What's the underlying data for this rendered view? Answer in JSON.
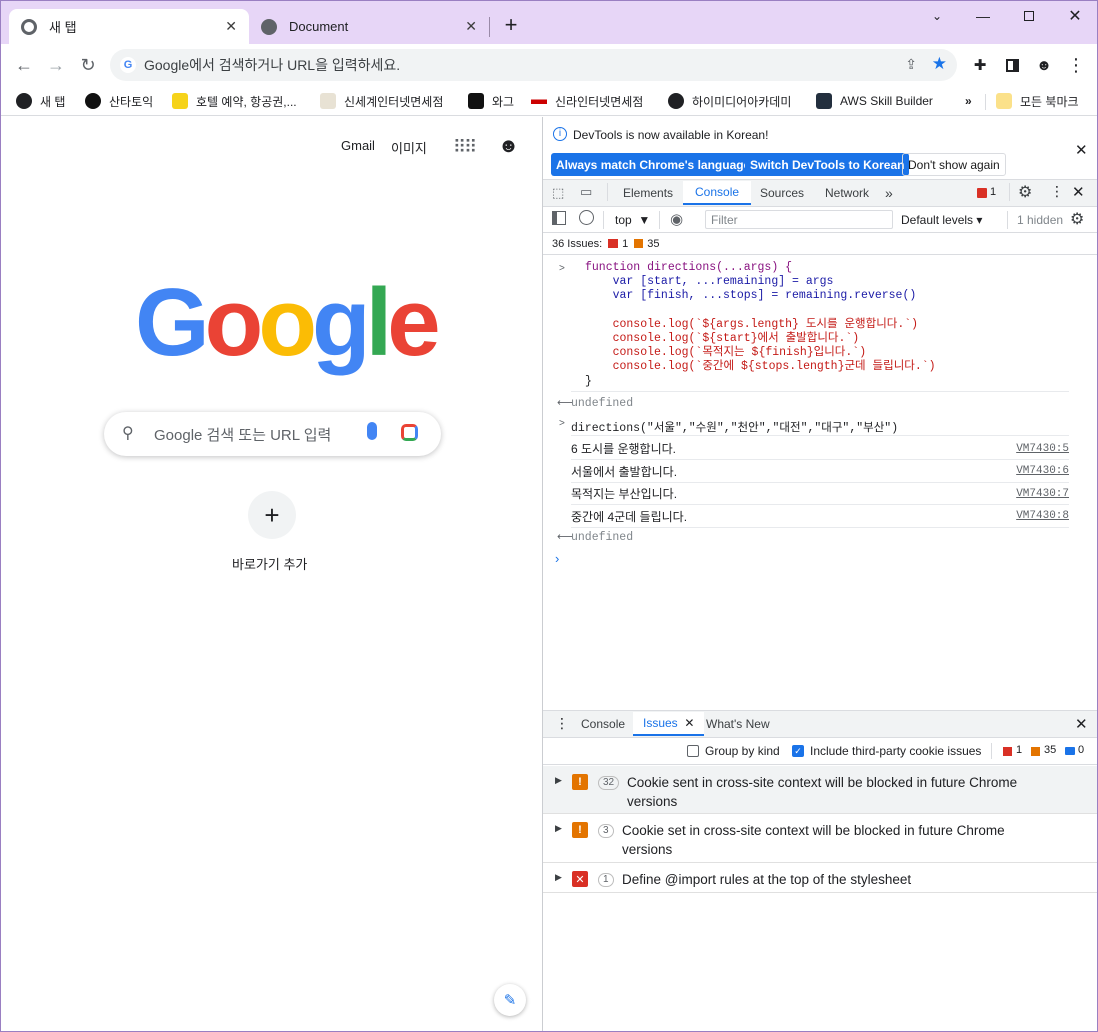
{
  "tabs": [
    {
      "label": "새 탭"
    },
    {
      "label": "Document"
    }
  ],
  "omnibox": {
    "placeholder": "Google에서 검색하거나 URL을 입력하세요."
  },
  "bookmarks": [
    {
      "label": "새 탭"
    },
    {
      "label": "산타토익"
    },
    {
      "label": "호텔 예약, 항공권,..."
    },
    {
      "label": "신세계인터넷면세점"
    },
    {
      "label": "와그"
    },
    {
      "label": "신라인터넷면세점"
    },
    {
      "label": "하이미디어아카데미"
    },
    {
      "label": "AWS Skill Builder"
    }
  ],
  "bookmarks_more": "»",
  "bookmarks_all": "모든 북마크",
  "ntp": {
    "gmail": "Gmail",
    "images": "이미지",
    "search_placeholder": "Google 검색 또는 URL 입력",
    "shortcut_label": "바로가기 추가"
  },
  "devtools": {
    "infobar_text": "DevTools is now available in Korean!",
    "btn_match": "Always match Chrome's language",
    "btn_switch": "Switch DevTools to Korean",
    "btn_dont": "Don't show again",
    "tabs": [
      "Elements",
      "Console",
      "Sources",
      "Network"
    ],
    "error_count": "1",
    "context": "top",
    "filter_placeholder": "Filter",
    "levels": "Default levels",
    "hidden": "1 hidden",
    "issues_summary": {
      "label": "36 Issues:",
      "errors": "1",
      "warnings": "35"
    },
    "code": [
      "function directions(...args) {",
      "    var [start, ...remaining] = args",
      "    var [finish, ...stops] = remaining.reverse()",
      "",
      "    console.log(`${args.length} 도시를 운행합니다.`)",
      "    console.log(`${start}에서 출발합니다.`)",
      "    console.log(`목적지는 ${finish}입니다.`)",
      "    console.log(`중간에 ${stops.length}군데 들립니다.`)",
      "}"
    ],
    "undefined1": "undefined",
    "call": "directions(\"서울\",\"수원\",\"천안\",\"대전\",\"대구\",\"부산\")",
    "logs": [
      {
        "text": "6 도시를 운행합니다.",
        "src": "VM7430:5"
      },
      {
        "text": "서울에서 출발합니다.",
        "src": "VM7430:6"
      },
      {
        "text": "목적지는 부산입니다.",
        "src": "VM7430:7"
      },
      {
        "text": "중간에 4군데 들립니다.",
        "src": "VM7430:8"
      }
    ],
    "undefined2": "undefined",
    "drawer": {
      "tabs": [
        "Console",
        "Issues",
        "What's New"
      ],
      "group_by_kind": "Group by kind",
      "include_third_party": "Include third-party cookie issues",
      "counts": {
        "errors": "1",
        "warnings": "35",
        "info": "0"
      },
      "issues": [
        {
          "count": "32",
          "text": "Cookie sent in cross-site context will be blocked in future Chrome versions",
          "kind": "warning"
        },
        {
          "count": "3",
          "text": "Cookie set in cross-site context will be blocked in future Chrome versions",
          "kind": "warning"
        },
        {
          "count": "1",
          "text": "Define @import rules at the top of the stylesheet",
          "kind": "error"
        }
      ]
    }
  },
  "colors": {
    "accent": "#1a73e8",
    "tabstrip": "#e7d6f7",
    "error": "#d93025",
    "warning": "#e37400"
  }
}
